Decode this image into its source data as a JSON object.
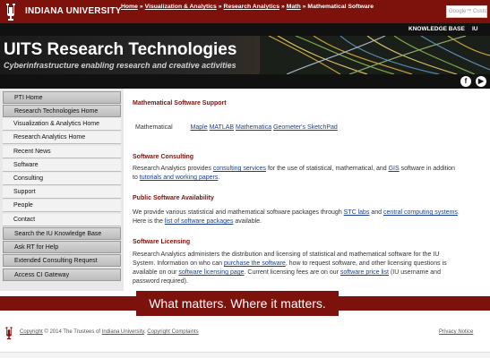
{
  "header": {
    "university_name": "INDIANA UNIVERSITY",
    "search_placeholder": "Google™ Custom"
  },
  "top_nav": {
    "knowledge_base": "KNOWLEDGE BASE",
    "iu_link": "IU"
  },
  "banner": {
    "title": "UITS Research Technologies",
    "subtitle": "Cyberinfrastructure enabling research and creative activities"
  },
  "breadcrumb": {
    "items": [
      "Home",
      "Visualization & Analytics",
      "Research Analytics",
      "Math"
    ],
    "separator": "»",
    "current": "Mathematical Software"
  },
  "sidebar": {
    "items": [
      {
        "label": "PTI Home"
      },
      {
        "label": "Research Technologies Home"
      },
      {
        "label": "Visualization & Analytics Home"
      },
      {
        "label": "Research Analytics Home"
      },
      {
        "label": "Recent News"
      },
      {
        "label": "Software"
      },
      {
        "label": "Consulting"
      },
      {
        "label": "Support"
      },
      {
        "label": "People"
      },
      {
        "label": "Contact"
      },
      {
        "label": "Search the IU Knowledge Base"
      },
      {
        "label": "Ask RT for Help"
      },
      {
        "label": "Extended Consulting Request"
      },
      {
        "label": "Access CI Gateway"
      }
    ]
  },
  "main": {
    "title": "Mathematical Software Support",
    "math_row": {
      "label": "Mathematical",
      "links": [
        "Maple",
        "MATLAB",
        "Mathematica",
        "Geometer's SketchPad"
      ]
    },
    "consulting": {
      "heading": "Software Consulting",
      "t1": "Research Analytics provides ",
      "l1": "consulting services",
      "t2": " for the use of statistical, mathematical, and ",
      "l2": "GIS",
      "t3": " software in addition to ",
      "l3": "tutorials and working papers",
      "t4": "."
    },
    "availability": {
      "heading": "Public Software Availability",
      "t1": "We provide various statistical and mathematical software packages through ",
      "l1": "STC labs",
      "t2": " and ",
      "l2": "central computing systems",
      "t3": ". Here is the ",
      "l3": "list of software packages",
      "t4": " available."
    },
    "licensing": {
      "heading": "Software Licensing",
      "t1": "Research Analytics administers the distribution and licensing of statistical and mathematical software for the IU System. Information on who can ",
      "l1": "purchase the software",
      "t2": ", how to request software, and other licensing questions is available on our ",
      "l2": "software licensing page",
      "t3": ". Current licensing fees are on our ",
      "l3": "software price list",
      "t4": " (IU username and password required)."
    }
  },
  "footer": {
    "motto": "What matters. Where it matters.",
    "copyright_link": "Copyright",
    "copyright_text": " © 2014 The Trustees of ",
    "iu_link": "Indiana University",
    "complaints_link": "Copyright Complaints",
    "privacy": "Privacy Notice"
  },
  "colors": {
    "crimson": "#7d110c",
    "black_bar": "#111111",
    "link": "#1a3f8c"
  }
}
